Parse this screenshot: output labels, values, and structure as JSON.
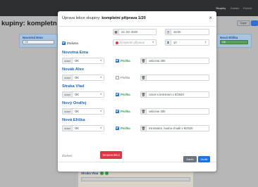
{
  "background": {
    "nav": [
      "Skupiny",
      "Zadání",
      "Ročník"
    ],
    "title": "kupiny: kompletn",
    "right_button": "Kopie",
    "left_card": {
      "name": "Novotná Ema",
      "value": "OK"
    },
    "right_card": {
      "name": "Nová Eliška",
      "value": "OK"
    },
    "lower_rows": [
      {
        "name": "Nový Ale",
        "value": "OK"
      },
      {
        "name": "Straka Vlas",
        "value": ""
      }
    ]
  },
  "modal": {
    "title_prefix": "Úprava lekce skupiny:",
    "title_bold": "kompletní příprava 1/20",
    "close_symbol": "×",
    "date": "24. 03. 2020",
    "time": "16:00",
    "zrusena_label": "Zrušena",
    "status_placeholder": "Kompletní příprava",
    "count_value": "10",
    "students": [
      {
        "name": "Novotná Ema",
        "ucast_label": "účast",
        "ucast": "OK",
        "pisemka_checked": true,
        "pisemka_label": "Písěka",
        "note": "velicena 300"
      },
      {
        "name": "Novák Alex",
        "ucast_label": "účast",
        "ucast": "OK",
        "pisemka_checked": false,
        "pisemka_label": "Písěka",
        "note": ""
      },
      {
        "name": "Straka Vlad",
        "ucast_label": "účast",
        "ucast": "OK",
        "pisemka_checked": true,
        "pisemka_label": "Písěka",
        "note": "cvicet s terminem v 8/2020"
      },
      {
        "name": "Nový Ondřej",
        "ucast_label": "účast",
        "ucast": "OK",
        "pisemka_checked": true,
        "pisemka_label": "Písěka",
        "note": "velicene 300"
      },
      {
        "name": "Nová Eliška",
        "ucast_label": "účast",
        "ucast": "OK",
        "pisemka_checked": true,
        "pisemka_label": "Písěka",
        "note": "minimalen, budou chodit v 8/2020"
      }
    ],
    "footer": {
      "zrusit": "Zrušení",
      "smazat": "Smazat lekci",
      "zavrit": "Zavřít",
      "ulozit": "Uložit"
    }
  },
  "colors": {
    "accent": "#1a73e8",
    "danger": "#dc3545",
    "name_blue": "#1d67c4",
    "success_text": "#28a745"
  }
}
